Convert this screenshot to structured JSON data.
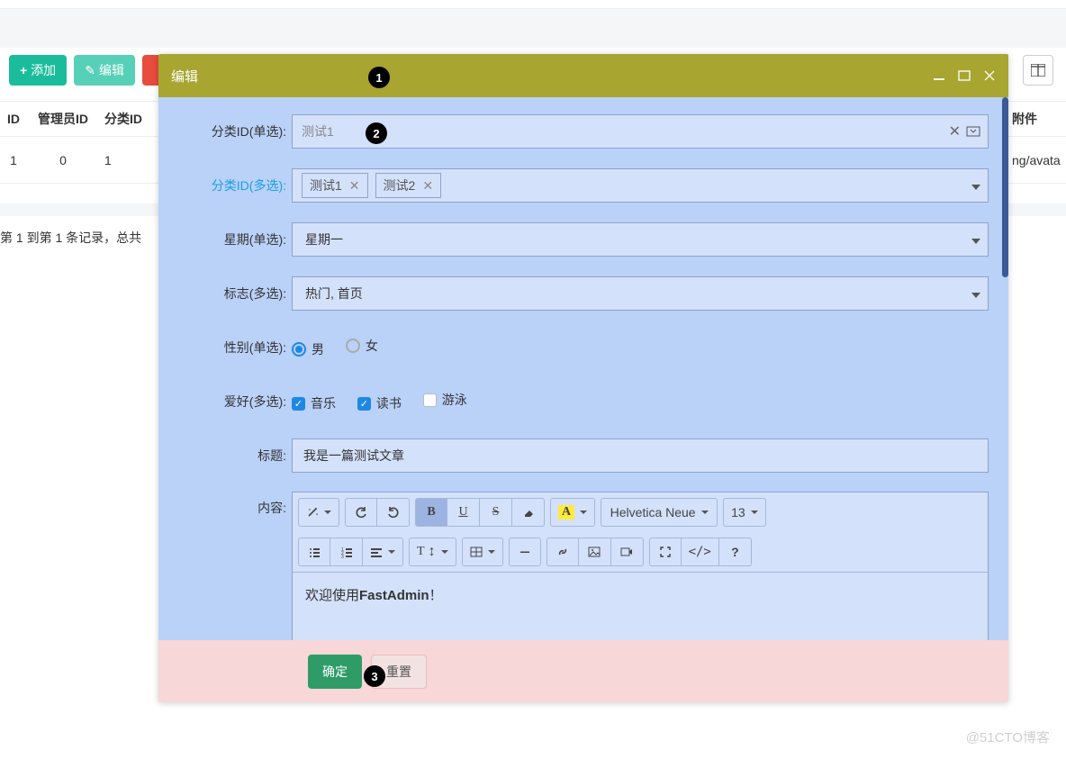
{
  "toolbar": {
    "add_label": "添加",
    "edit_label": "编辑"
  },
  "table": {
    "headers": {
      "id": "ID",
      "admin_id": "管理员ID",
      "category_id": "分类ID",
      "attachment": "附件"
    },
    "row": {
      "id": "1",
      "admin_id": "0",
      "category_id": "1",
      "attachment": "ng/avata"
    }
  },
  "pager_info": "第 1 到第 1 条记录，总共",
  "dialog": {
    "title": "编辑",
    "fields": {
      "category_single": {
        "label": "分类ID(单选):",
        "value": "测试1"
      },
      "category_multi": {
        "label": "分类ID(多选):",
        "tags": [
          "测试1",
          "测试2"
        ]
      },
      "week": {
        "label": "星期(单选):",
        "value": "星期一"
      },
      "flags": {
        "label": "标志(多选):",
        "value": "热门, 首页"
      },
      "gender": {
        "label": "性别(单选):",
        "options": [
          {
            "label": "男",
            "checked": true
          },
          {
            "label": "女",
            "checked": false
          }
        ]
      },
      "hobby": {
        "label": "爱好(多选):",
        "options": [
          {
            "label": "音乐",
            "checked": true
          },
          {
            "label": "读书",
            "checked": true
          },
          {
            "label": "游泳",
            "checked": false
          }
        ]
      },
      "title": {
        "label": "标题:",
        "value": "我是一篇测试文章"
      },
      "content": {
        "label": "内容:",
        "body_prefix": "欢迎使用",
        "body_bold": "FastAdmin",
        "body_suffix": "！"
      }
    },
    "editor": {
      "font_label": "Helvetica Neue",
      "size_label": "13"
    },
    "footer": {
      "ok": "确定",
      "reset": "重置"
    }
  },
  "annotations": {
    "a1": "1",
    "a2": "2",
    "a3": "3"
  },
  "watermark": "@51CTO博客"
}
